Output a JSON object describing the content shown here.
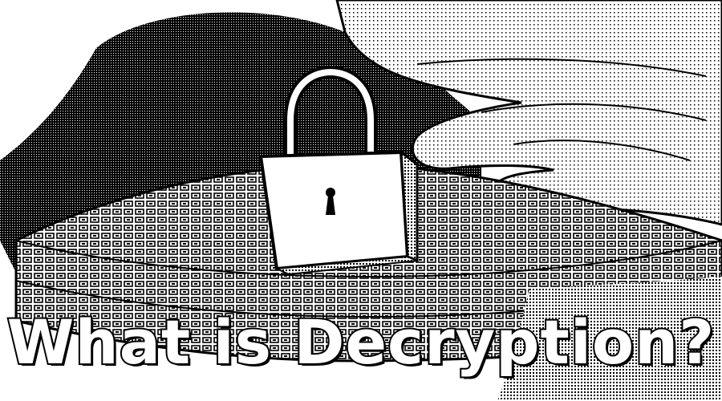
{
  "title": "What is Decryption?",
  "image": {
    "subject": "padlock-icon",
    "colors": {
      "ink": "#000000",
      "paper": "#ffffff",
      "shade": "#6a6a6a"
    }
  }
}
